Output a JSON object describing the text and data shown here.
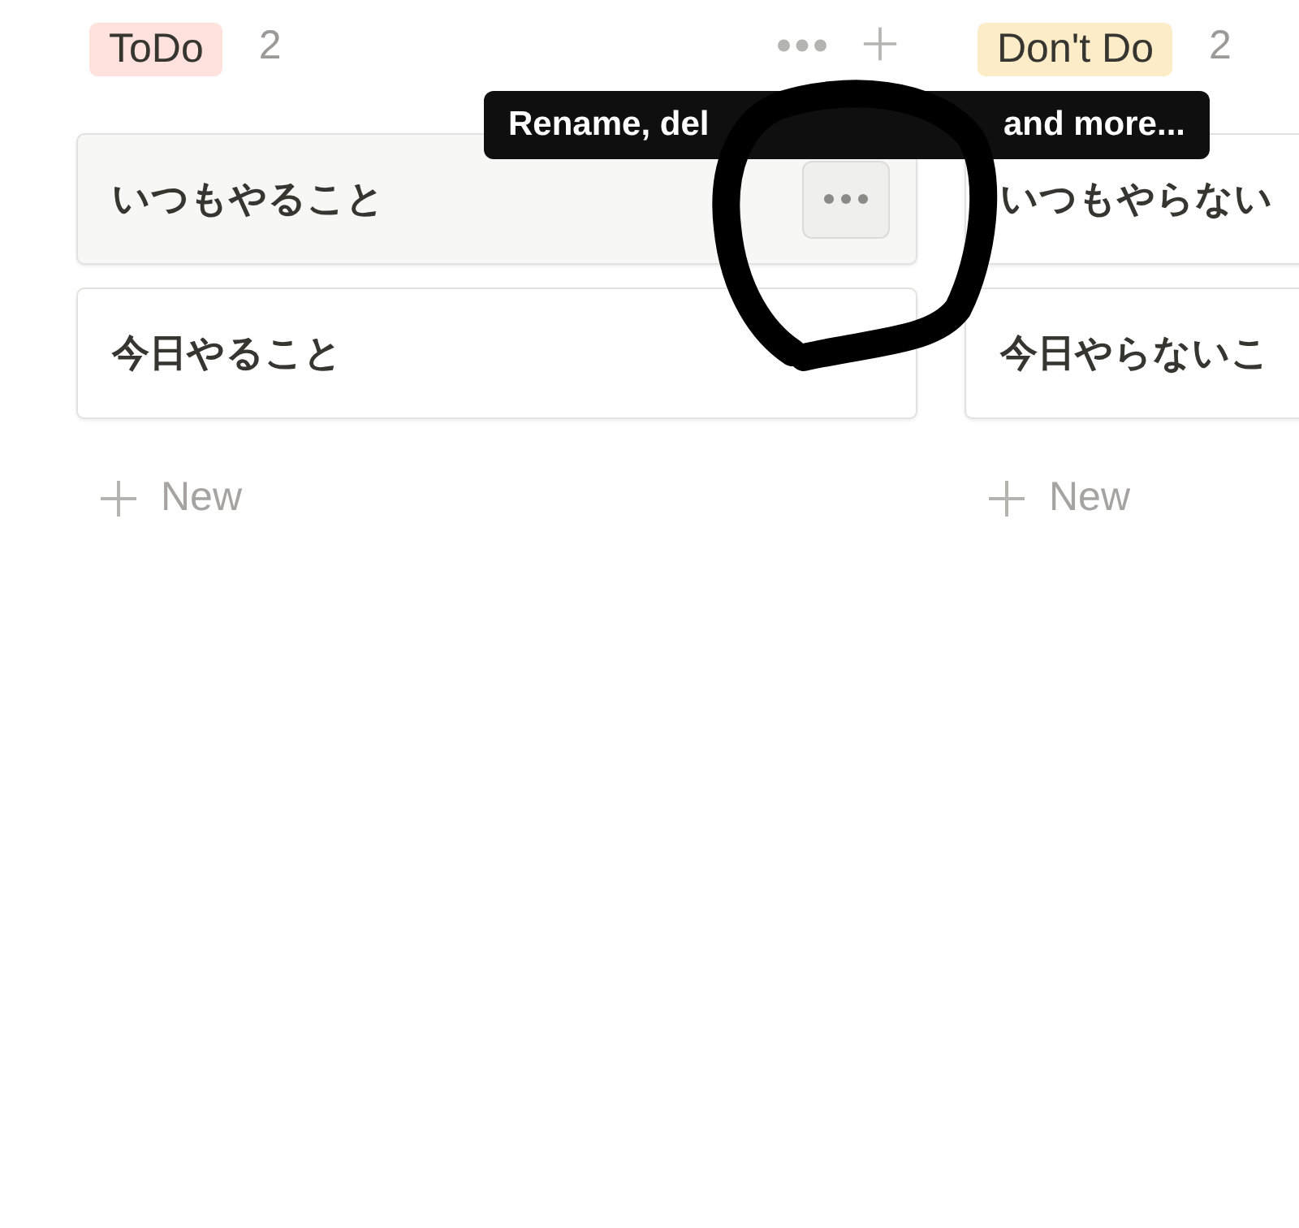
{
  "columns": [
    {
      "label": "ToDo",
      "color": "#ffe2dd",
      "count": "2",
      "show_actions": true,
      "cards": [
        {
          "title": "いつもやること",
          "hovered": true
        },
        {
          "title": "今日やること",
          "hovered": false
        }
      ],
      "new_label": "New"
    },
    {
      "label": "Don't Do",
      "color": "#fdecc8",
      "count": "2",
      "cards": [
        {
          "title": "いつもやらない"
        },
        {
          "title": "今日やらないこ"
        }
      ],
      "new_label": "New"
    }
  ],
  "tooltip": {
    "parts": [
      "Rename, del",
      "and more..."
    ]
  }
}
